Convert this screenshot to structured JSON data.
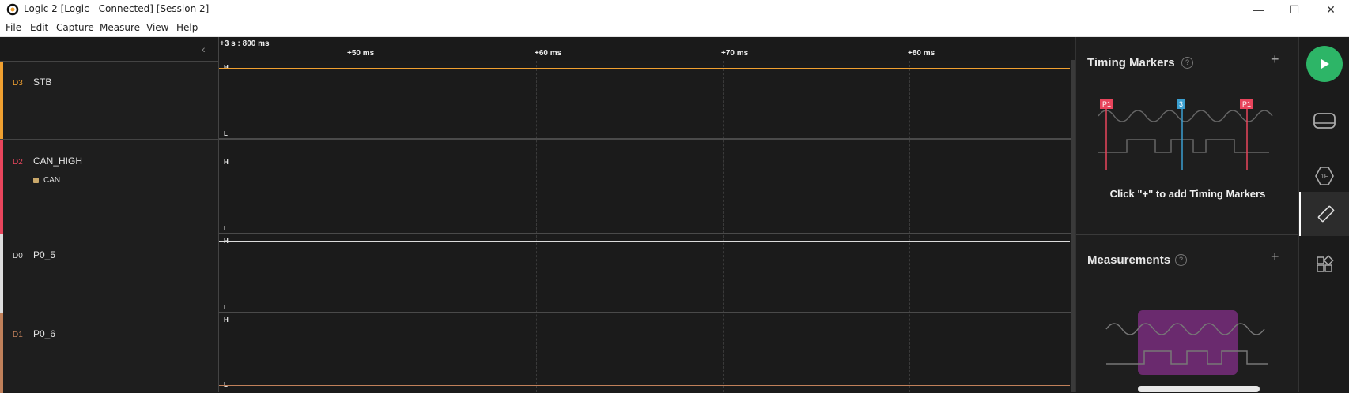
{
  "window": {
    "title": "Logic 2 [Logic - Connected] [Session 2]",
    "minimize": "—",
    "maximize": "☐",
    "close": "✕"
  },
  "menu": [
    "File",
    "Edit",
    "Capture",
    "Measure",
    "View",
    "Help"
  ],
  "timeline": {
    "origin": "+3 s : 800 ms",
    "ticks": [
      "+50 ms",
      "+60 ms",
      "+70 ms",
      "+80 ms"
    ]
  },
  "channels": [
    {
      "id": "D3",
      "name": "STB",
      "color": "#f0a030",
      "level": "high",
      "analyzer": ""
    },
    {
      "id": "D2",
      "name": "CAN_HIGH",
      "color": "#e8455c",
      "level": "high",
      "analyzer": "CAN"
    },
    {
      "id": "D0",
      "name": "P0_5",
      "color": "#dddddd",
      "level": "high",
      "analyzer": ""
    },
    {
      "id": "D1",
      "name": "P0_6",
      "color": "#c0805a",
      "level": "low",
      "analyzer": ""
    }
  ],
  "levels": {
    "high": "H",
    "low": "L"
  },
  "panel": {
    "timing_title": "Timing Markers",
    "timing_hint": "Click \"+\" to add Timing Markers",
    "marker_labels": [
      "P1",
      "3",
      "P1"
    ],
    "measurements_title": "Measurements",
    "help": "?",
    "add": "+"
  },
  "colors": {
    "accent_green": "#2db567",
    "marker_red": "#e8455c",
    "marker_blue": "#3a9fd0",
    "measure_purple": "#6a2a6e"
  }
}
